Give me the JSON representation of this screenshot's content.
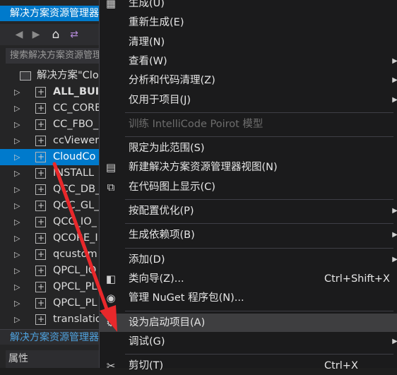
{
  "explorer": {
    "title": "解决方案资源管理器",
    "toolbar": {
      "back": "◀",
      "forward": "▶",
      "home": "⌂",
      "sync": "⇄"
    },
    "search_placeholder": "搜索解决方案资源管理",
    "root": "解决方案\"Clo",
    "projects": [
      {
        "label": "ALL_BUI",
        "bold": true,
        "selected": false
      },
      {
        "label": "CC_CORE",
        "bold": false,
        "selected": false
      },
      {
        "label": "CC_FBO_",
        "bold": false,
        "selected": false
      },
      {
        "label": "ccViewer",
        "bold": false,
        "selected": false
      },
      {
        "label": "CloudCo",
        "bold": false,
        "selected": true
      },
      {
        "label": "INSTALL",
        "bold": false,
        "selected": false
      },
      {
        "label": "QCC_DB_",
        "bold": false,
        "selected": false
      },
      {
        "label": "QCC_GL_",
        "bold": false,
        "selected": false
      },
      {
        "label": "QCC_IO_",
        "bold": false,
        "selected": false
      },
      {
        "label": "QCORE_I",
        "bold": false,
        "selected": false
      },
      {
        "label": "qcustom",
        "bold": false,
        "selected": false
      },
      {
        "label": "QPCL_IO",
        "bold": false,
        "selected": false
      },
      {
        "label": "QPCL_PL",
        "bold": false,
        "selected": false
      },
      {
        "label": "QPCL_PL",
        "bold": false,
        "selected": false
      },
      {
        "label": "translatio",
        "bold": false,
        "selected": false
      }
    ],
    "bottom_tab": "解决方案资源管理器",
    "properties": "属性"
  },
  "menu": {
    "items": [
      {
        "label": "生成(U)",
        "icon": "build-icon"
      },
      {
        "label": "重新生成(E)"
      },
      {
        "label": "清理(N)"
      },
      {
        "label": "查看(W)",
        "submenu": true
      },
      {
        "label": "分析和代码清理(Z)",
        "submenu": true
      },
      {
        "label": "仅用于项目(J)",
        "submenu": true
      },
      {
        "separator": true
      },
      {
        "label": "训练 IntelliCode Poirot 模型",
        "disabled": true
      },
      {
        "separator": true
      },
      {
        "label": "限定为此范围(S)"
      },
      {
        "label": "新建解决方案资源管理器视图(N)",
        "icon": "new-view-icon"
      },
      {
        "label": "在代码图上显示(C)",
        "icon": "code-map-icon"
      },
      {
        "separator": true
      },
      {
        "label": "按配置优化(P)",
        "submenu": true
      },
      {
        "separator": true
      },
      {
        "label": "生成依赖项(B)",
        "submenu": true
      },
      {
        "separator": true
      },
      {
        "label": "添加(D)",
        "submenu": true
      },
      {
        "label": "类向导(Z)...",
        "shortcut": "Ctrl+Shift+X",
        "icon": "class-wizard-icon"
      },
      {
        "label": "管理 NuGet 程序包(N)...",
        "icon": "nuget-icon"
      },
      {
        "separator": true
      },
      {
        "label": "设为启动项目(A)",
        "icon": "gear-icon",
        "hover": true
      },
      {
        "label": "调试(G)",
        "submenu": true
      },
      {
        "separator": true
      },
      {
        "label": "剪切(T)",
        "shortcut": "Ctrl+X",
        "icon": "scissors-icon"
      }
    ]
  },
  "colors": {
    "accent": "#007acc",
    "annotation_arrow": "#e8282b"
  }
}
